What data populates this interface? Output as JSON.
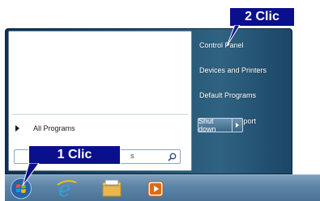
{
  "start_menu": {
    "all_programs": "All Programs",
    "search_text": "s",
    "right_items": [
      "Control Panel",
      "Devices and Printers",
      "Default Programs",
      "Help and Support"
    ],
    "shutdown": "Shut down"
  },
  "callouts": {
    "step1": "1 Clic",
    "step2": "2 Clic"
  },
  "taskbar": {
    "icons": [
      "windows-orb-icon",
      "internet-explorer-icon",
      "file-explorer-icon",
      "media-player-icon"
    ]
  },
  "colors": {
    "callout_bg": "#0a0f8c",
    "menu_bg": "#1f4d6c",
    "taskbar": "#5e86a8"
  }
}
